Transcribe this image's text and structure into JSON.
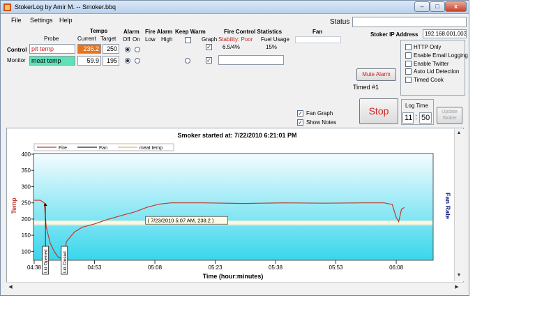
{
  "window": {
    "title": "StokerLog by Amir M. -- Smoker.bbq",
    "minimize": "–",
    "maximize": "□",
    "close": "x"
  },
  "menu": [
    "File",
    "Settings",
    "Help"
  ],
  "status": {
    "label": "Status",
    "value": ""
  },
  "headers": {
    "probe": "Probe",
    "temps": "Temps",
    "current": "Current",
    "target": "Target",
    "alarm": "Alarm",
    "off": "Off",
    "on": "On",
    "fire_alarm": "Fire Alarm",
    "low": "Low",
    "high": "High",
    "keep_warm": "Keep Warm",
    "graph": "Graph",
    "fire_control_statistics": "Fire Control Statistics",
    "stability": "Stability: Poor",
    "fuel_usage": "Fuel Usage",
    "fan": "Fan"
  },
  "rows": [
    {
      "role": "Control",
      "probe_name": "pit temp",
      "current": "236.2",
      "target": "250",
      "alarm": "off",
      "keep_warm_checked": false,
      "graph_checked": true,
      "stat": "6.5/4%",
      "fuel": "15%"
    },
    {
      "role": "Monitor",
      "probe_name": "meat temp",
      "current": "59.9",
      "target": "195",
      "alarm": "off",
      "keep_warm_checked": false,
      "graph_checked": true,
      "fan_field": ""
    }
  ],
  "stoker_ip": {
    "label": "Stoker IP Address",
    "value": "192.168.001.003"
  },
  "options": [
    {
      "label": "HTTP Only",
      "checked": false
    },
    {
      "label": "Enable Email Logging",
      "checked": false
    },
    {
      "label": "Enable Twitter",
      "checked": false
    },
    {
      "label": "Auto Lid Detection",
      "checked": false
    },
    {
      "label": "Timed Cook",
      "checked": false
    }
  ],
  "mute_alarm": "Mute Alarm",
  "timed": "Timed #1",
  "fan_graph": {
    "label": "Fan Graph",
    "checked": true
  },
  "show_notes": {
    "label": "Show Notes",
    "checked": true
  },
  "stop_button": "Stop",
  "log_time": {
    "label": "Log Time",
    "minutes": "11",
    "separator": ":",
    "seconds": "50"
  },
  "update_button": "Update Stoker",
  "colors": {
    "fire": "#c0392b",
    "fan": "#222222",
    "meat": "#d8b56a",
    "stop": "#cc1f1f",
    "mute": "#cc1f1f",
    "current_bg": "#e8741c",
    "monitor_bg": "#5fe0b8",
    "axis_left": "#c0392b",
    "axis_right": "#1a237e"
  },
  "chart_data": {
    "type": "line",
    "title": "Smoker started at: 7/22/2010 6:21:01 PM",
    "xlabel": "Time (hour:minutes)",
    "ylabel": "Temp",
    "y2label": "Fan Rate",
    "ylim": [
      75,
      400
    ],
    "yticks": [
      100,
      150,
      200,
      250,
      300,
      350,
      400
    ],
    "xlim": [
      278,
      377
    ],
    "xticks": [
      {
        "v": 278,
        "label": "04:38"
      },
      {
        "v": 293,
        "label": "04:53"
      },
      {
        "v": 308,
        "label": "05:08"
      },
      {
        "v": 323,
        "label": "05:23"
      },
      {
        "v": 338,
        "label": "05:38"
      },
      {
        "v": 353,
        "label": "05:53"
      },
      {
        "v": 368,
        "label": "06:08"
      }
    ],
    "legend": [
      "Fire",
      "Fan",
      "meat temp"
    ],
    "legend_position": "top-left",
    "grid": false,
    "band": [
      180,
      195
    ],
    "series": [
      {
        "name": "Fire",
        "x": [
          278,
          279.5,
          280.5,
          281,
          282,
          283,
          284,
          285,
          285.5,
          286,
          288,
          290,
          293,
          296,
          300,
          303,
          306,
          309,
          312,
          320,
          330,
          340,
          350,
          360,
          365,
          367,
          368,
          368.6,
          369.3,
          370
        ],
        "y": [
          258,
          258,
          250,
          175,
          125,
          100,
          82,
          78,
          82,
          130,
          160,
          175,
          185,
          198,
          212,
          222,
          236,
          246,
          250,
          250,
          248,
          250,
          249,
          250,
          250,
          245,
          205,
          192,
          230,
          236
        ]
      }
    ],
    "annotations": [
      {
        "text": "( 7/23/2010 5:07 AM, 238.2 )",
        "x": 306,
        "y": 238
      },
      {
        "text": "Lid Opened",
        "x": 280.8,
        "y": 258
      },
      {
        "text": "Lid Closed",
        "x": 285.5,
        "y": 90
      }
    ]
  }
}
